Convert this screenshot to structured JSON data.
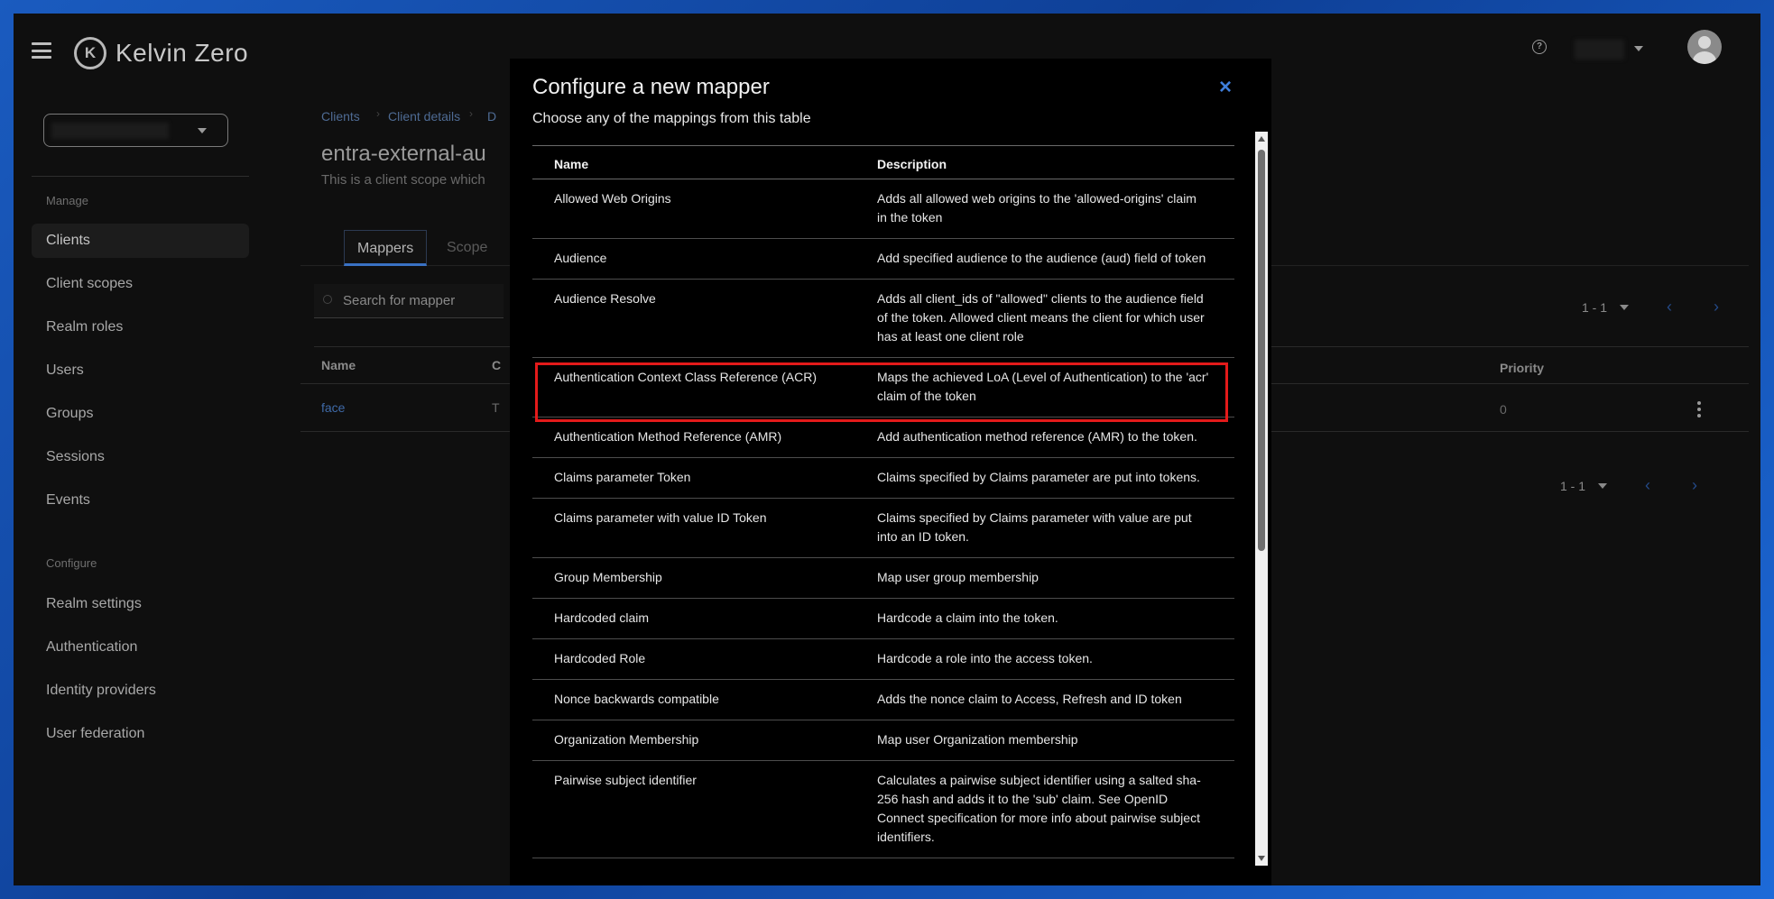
{
  "app": {
    "name": "Kelvin Zero",
    "logo_letter": "K"
  },
  "sidebar": {
    "manage_label": "Manage",
    "manage_items": [
      "Clients",
      "Client scopes",
      "Realm roles",
      "Users",
      "Groups",
      "Sessions",
      "Events"
    ],
    "configure_label": "Configure",
    "configure_items": [
      "Realm settings",
      "Authentication",
      "Identity providers",
      "User federation"
    ]
  },
  "background": {
    "breadcrumb": [
      "Clients",
      "Client details",
      "D"
    ],
    "title": "entra-external-au",
    "subtitle": "This is a client scope which",
    "tabs": [
      "Mappers",
      "Scope"
    ],
    "search_placeholder": "Search for mapper",
    "pagination": "1 - 1",
    "columns": {
      "name": "Name",
      "cat": "C",
      "priority": "Priority"
    },
    "row": {
      "name": "face",
      "cat": "T",
      "priority": "0"
    }
  },
  "modal": {
    "title": "Configure a new mapper",
    "description": "Choose any of the mappings from this table",
    "close": "×",
    "columns": {
      "name": "Name",
      "description": "Description"
    },
    "rows": [
      {
        "name": "Allowed Web Origins",
        "description": "Adds all allowed web origins to the 'allowed-origins' claim in the token"
      },
      {
        "name": "Audience",
        "description": "Add specified audience to the audience (aud) field of token"
      },
      {
        "name": "Audience Resolve",
        "description": "Adds all client_ids of \"allowed\" clients to the audience field of the token. Allowed client means the client for which user has at least one client role"
      },
      {
        "name": "Authentication Context Class Reference (ACR)",
        "description": "Maps the achieved LoA (Level of Authentication) to the 'acr' claim of the token"
      },
      {
        "name": "Authentication Method Reference (AMR)",
        "description": "Add authentication method reference (AMR) to the token."
      },
      {
        "name": "Claims parameter Token",
        "description": "Claims specified by Claims parameter are put into tokens."
      },
      {
        "name": "Claims parameter with value ID Token",
        "description": "Claims specified by Claims parameter with value are put into an ID token."
      },
      {
        "name": "Group Membership",
        "description": "Map user group membership"
      },
      {
        "name": "Hardcoded claim",
        "description": "Hardcode a claim into the token."
      },
      {
        "name": "Hardcoded Role",
        "description": "Hardcode a role into the access token."
      },
      {
        "name": "Nonce backwards compatible",
        "description": "Adds the nonce claim to Access, Refresh and ID token"
      },
      {
        "name": "Organization Membership",
        "description": "Map user Organization membership"
      },
      {
        "name": "Pairwise subject identifier",
        "description": "Calculates a pairwise subject identifier using a salted sha-256 hash and adds it to the 'sub' claim. See OpenID Connect specification for more info about pairwise subject identifiers."
      }
    ]
  },
  "colors": {
    "accent": "#3f7fdc",
    "highlight": "#e31a1a"
  }
}
